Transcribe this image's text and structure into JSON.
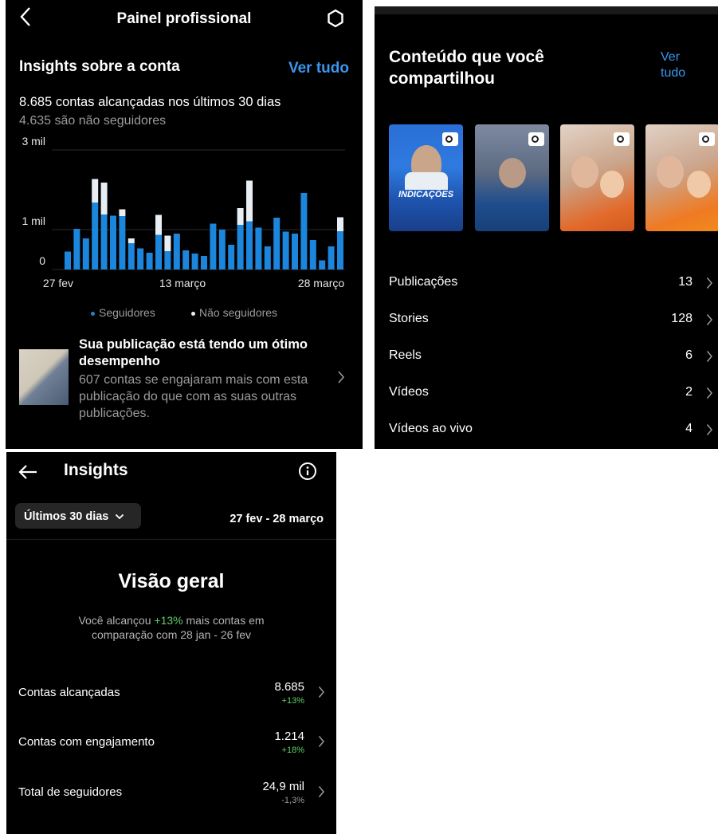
{
  "dashboard": {
    "title": "Painel profissional",
    "section_title": "Insights sobre a conta",
    "see_all": "Ver tudo",
    "reach_text": "8.685 contas alcançadas nos últimos 30 dias",
    "non_followers_text": "4.635 são não seguidores",
    "performance_title": "Sua publicação está tendo um ótimo desempenho",
    "performance_sub": "607 contas se engajaram mais com esta publicação do que com as suas outras publicações."
  },
  "chart_data": {
    "type": "bar",
    "y_ticks": [
      "3 mil",
      "1 mil",
      "0"
    ],
    "x_ticks": [
      "27 fev",
      "13 março",
      "28 março"
    ],
    "ylim": [
      0,
      3000
    ],
    "series": [
      {
        "name": "Seguidores",
        "values": [
          450,
          1020,
          780,
          1680,
          1380,
          1350,
          1340,
          660,
          530,
          420,
          870,
          460,
          900,
          480,
          400,
          340,
          1150,
          1000,
          620,
          1120,
          1210,
          1050,
          580,
          1300,
          950,
          900,
          1920,
          740,
          230,
          580,
          960
        ]
      },
      {
        "name": "Não seguidores",
        "values": [
          0,
          0,
          0,
          590,
          800,
          0,
          170,
          120,
          0,
          0,
          500,
          390,
          0,
          0,
          0,
          0,
          0,
          0,
          0,
          420,
          1020,
          0,
          0,
          0,
          0,
          0,
          0,
          0,
          0,
          0,
          350
        ]
      }
    ],
    "legend": [
      "Seguidores",
      "Não seguidores"
    ],
    "colors": {
      "followers": "#1c86dc",
      "non_followers": "#e9eef4"
    }
  },
  "content": {
    "title": "Conteúdo que você compartilhou",
    "see_all": "Ver tudo",
    "story1_caption": "INDICAÇÕES",
    "rows": [
      {
        "label": "Publicações",
        "count": "13"
      },
      {
        "label": "Stories",
        "count": "128"
      },
      {
        "label": "Reels",
        "count": "6"
      },
      {
        "label": "Vídeos",
        "count": "2"
      },
      {
        "label": "Vídeos ao vivo",
        "count": "4"
      }
    ]
  },
  "insights": {
    "title": "Insights",
    "range_label": "Últimos 30 dias",
    "date_range": "27 fev - 28 março",
    "overview_title": "Visão geral",
    "overview_pre": "Você alcançou ",
    "overview_pct": "+13%",
    "overview_post": " mais contas em comparação com 28 jan - 26 fev",
    "metrics": [
      {
        "label": "Contas alcançadas",
        "value": "8.685",
        "change": "+13%"
      },
      {
        "label": "Contas com engajamento",
        "value": "1.214",
        "change": "+18%"
      },
      {
        "label": "Total de seguidores",
        "value": "24,9 mil",
        "change": "-1,3%"
      }
    ]
  },
  "colors": {
    "accent_blue": "#3897f0",
    "positive": "#5fcf6a",
    "background": "#000000"
  }
}
